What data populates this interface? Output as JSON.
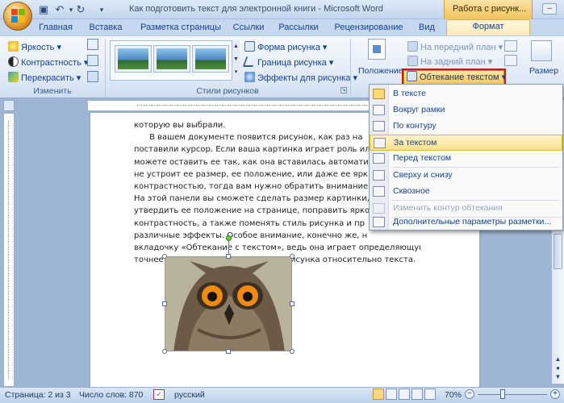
{
  "window": {
    "title": "Как подготовить текст для электронной книги - Microsoft Word",
    "context_tab_title": "Работа с рисунк..."
  },
  "quick_access": {
    "save": "save-icon",
    "undo": "undo-icon",
    "redo": "redo-icon"
  },
  "tabs": [
    "Главная",
    "Вставка",
    "Разметка страницы",
    "Ссылки",
    "Рассылки",
    "Рецензирование",
    "Вид",
    "Формат"
  ],
  "ribbon": {
    "adjust": {
      "label": "Изменить",
      "brightness": "Яркость",
      "contrast": "Контрастность",
      "recolor": "Перекрасить"
    },
    "styles": {
      "label": "Стили рисунков",
      "shape": "Форма рисунка",
      "border": "Граница рисунка",
      "effects": "Эффекты для рисунка"
    },
    "arrange": {
      "position": "Положение",
      "bring_front": "На передний план",
      "send_back": "На задний план",
      "text_wrap": "Обтекание текстом"
    },
    "size": {
      "label": "Размер"
    }
  },
  "wrap_menu": {
    "items": [
      {
        "label": "В тексте",
        "checked": true,
        "disabled": false
      },
      {
        "label": "Вокруг рамки",
        "checked": false,
        "disabled": false
      },
      {
        "label": "По контуру",
        "checked": false,
        "disabled": false
      },
      {
        "label": "За текстом",
        "checked": false,
        "disabled": false,
        "hover": true
      },
      {
        "label": "Перед текстом",
        "checked": false,
        "disabled": false
      },
      {
        "label": "Сверху и снизу",
        "checked": false,
        "disabled": false
      },
      {
        "label": "Сквозное",
        "checked": false,
        "disabled": false
      },
      {
        "label": "Изменить контур обтекания",
        "checked": false,
        "disabled": true
      },
      {
        "label": "Дополнительные параметры разметки...",
        "checked": false,
        "disabled": false
      }
    ]
  },
  "document": {
    "lines": [
      "которую вы выбрали.",
      "      В вашем документе появится рисунок, как раз на",
      "поставили курсор. Если ваша картинка играет роль ил",
      "можете оставить ее так, как она вставилась автоматич",
      "не устроит ее размер, ее положение, или даже ее ярк",
      "контрастностью, тогда вам нужно обратить внимание",
      "На этой панели вы сможете сделать размер картинки,",
      "утвердить ее положение на странице, поправить ярко",
      "контрастность, а также поменять стиль рисунка и пр",
      "различные эффекты. Особое внимание, конечно же, н",
      "вкладочку «Обтекание с текстом», ведь она играет определяющую, а",
      "точнее главную роль в положении рисунка относительно текста."
    ]
  },
  "status": {
    "page": "Страница: 2 из 3",
    "words": "Число слов: 870",
    "language": "русский",
    "zoom": "70%"
  }
}
